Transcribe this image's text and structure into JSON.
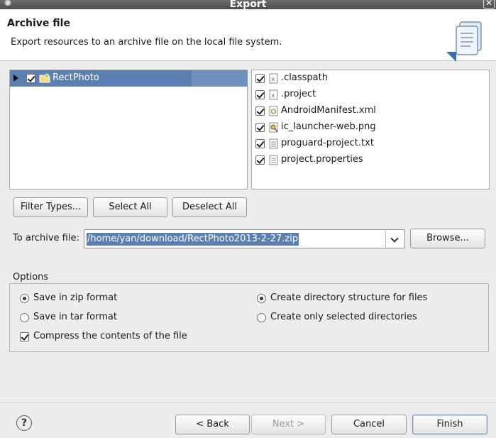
{
  "window": {
    "title": "Export"
  },
  "header": {
    "title": "Archive file",
    "description": "Export resources to an archive file on the local file system."
  },
  "tree": {
    "project": "RectPhoto"
  },
  "files": [
    {
      "name": ".classpath",
      "icon": "xml-file-icon"
    },
    {
      "name": ".project",
      "icon": "xml-file-icon"
    },
    {
      "name": "AndroidManifest.xml",
      "icon": "android-manifest-icon"
    },
    {
      "name": "ic_launcher-web.png",
      "icon": "image-file-icon"
    },
    {
      "name": "proguard-project.txt",
      "icon": "text-file-icon"
    },
    {
      "name": "project.properties",
      "icon": "text-file-icon"
    }
  ],
  "buttons": {
    "filter_types": "Filter Types...",
    "select_all": "Select All",
    "deselect_all": "Deselect All",
    "browse": "Browse...",
    "back": "< Back",
    "next": "Next >",
    "cancel": "Cancel",
    "finish": "Finish"
  },
  "archive": {
    "label": "To archive file:",
    "value": "/home/yan/download/RectPhoto2013-2-27.zip"
  },
  "options": {
    "legend": "Options",
    "zip": "Save in zip format",
    "tar": "Save in tar format",
    "compress": "Compress the contents of the file",
    "create_structure": "Create directory structure for files",
    "create_selected": "Create only selected directories"
  },
  "colors": {
    "selection": "#5b7fb0"
  }
}
